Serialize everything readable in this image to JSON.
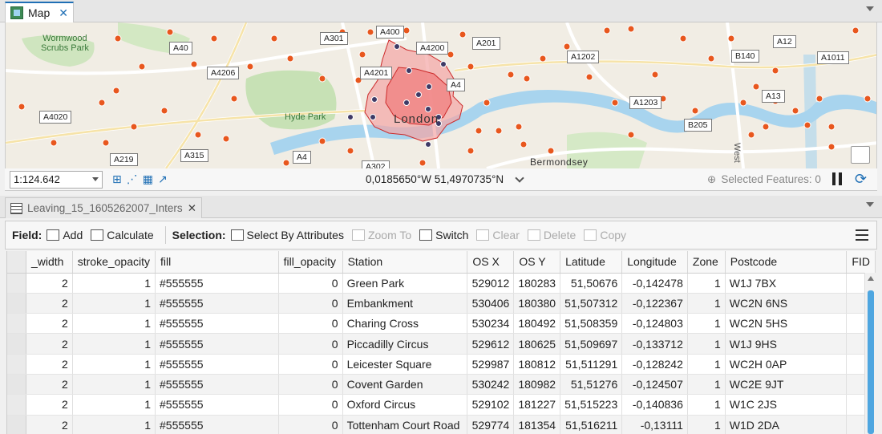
{
  "map_tab": {
    "title": "Map",
    "close": "✕"
  },
  "map": {
    "road_labels": [
      {
        "text": "A301"
      },
      {
        "text": "A400"
      },
      {
        "text": "A40"
      },
      {
        "text": "A4200"
      },
      {
        "text": "A201"
      },
      {
        "text": "A12"
      },
      {
        "text": "A1202"
      },
      {
        "text": "B140"
      },
      {
        "text": "A1011"
      },
      {
        "text": "A4206"
      },
      {
        "text": "A4201"
      },
      {
        "text": "A4"
      },
      {
        "text": "A1203"
      },
      {
        "text": "A13"
      },
      {
        "text": "A4020"
      },
      {
        "text": "B205"
      },
      {
        "text": "A219"
      },
      {
        "text": "A315"
      },
      {
        "text": "A4"
      },
      {
        "text": "A302"
      }
    ],
    "area_labels": {
      "wormwood": "Wormwood\nScrubs Park",
      "hyde": "Hyde Park"
    },
    "city_label": "London",
    "place_label": "Bermondsey",
    "side_label": "West"
  },
  "status": {
    "scale": "1:124.642",
    "coordinates": "0,0185650°W 51,4970735°N",
    "selected_features": "Selected Features: 0"
  },
  "attr_tab": {
    "title": "Leaving_15_1605262007_Inters",
    "close": "✕"
  },
  "toolbar": {
    "field_label": "Field:",
    "add": "Add",
    "calculate": "Calculate",
    "selection_label": "Selection:",
    "select_by_attributes": "Select By Attributes",
    "zoom_to": "Zoom To",
    "switch": "Switch",
    "clear": "Clear",
    "delete": "Delete",
    "copy": "Copy"
  },
  "table": {
    "columns": [
      "_width",
      "stroke_opacity",
      "fill",
      "fill_opacity",
      "Station",
      "OS X",
      "OS Y",
      "Latitude",
      "Longitude",
      "Zone",
      "Postcode",
      "FID"
    ],
    "rows": [
      [
        "2",
        "1",
        "#555555",
        "0",
        "Green Park",
        "529012",
        "180283",
        "51,50676",
        "-0,142478",
        "1",
        "W1J 7BX"
      ],
      [
        "2",
        "1",
        "#555555",
        "0",
        "Embankment",
        "530406",
        "180380",
        "51,507312",
        "-0,122367",
        "1",
        "WC2N 6NS"
      ],
      [
        "2",
        "1",
        "#555555",
        "0",
        "Charing Cross",
        "530234",
        "180492",
        "51,508359",
        "-0,124803",
        "1",
        "WC2N 5HS"
      ],
      [
        "2",
        "1",
        "#555555",
        "0",
        "Piccadilly Circus",
        "529612",
        "180625",
        "51,509697",
        "-0,133712",
        "1",
        "W1J 9HS"
      ],
      [
        "2",
        "1",
        "#555555",
        "0",
        "Leicester Square",
        "529987",
        "180812",
        "51,511291",
        "-0,128242",
        "1",
        "WC2H 0AP"
      ],
      [
        "2",
        "1",
        "#555555",
        "0",
        "Covent Garden",
        "530242",
        "180982",
        "51,51276",
        "-0,124507",
        "1",
        "WC2E 9JT"
      ],
      [
        "2",
        "1",
        "#555555",
        "0",
        "Oxford Circus",
        "529102",
        "181227",
        "51,515223",
        "-0,140836",
        "1",
        "W1C 2JS"
      ],
      [
        "2",
        "1",
        "#555555",
        "0",
        "Tottenham Court Road",
        "529774",
        "181354",
        "51,516211",
        "-0,13111",
        "1",
        "W1D 2DA"
      ]
    ]
  },
  "colors": {
    "accent": "#1f6fb5",
    "polygon_fill": "#f08080",
    "polygon_stroke": "#cc2a2a",
    "station_dot": "#e8571e",
    "river": "#a8d4ee",
    "park": "#c7e1b5"
  }
}
